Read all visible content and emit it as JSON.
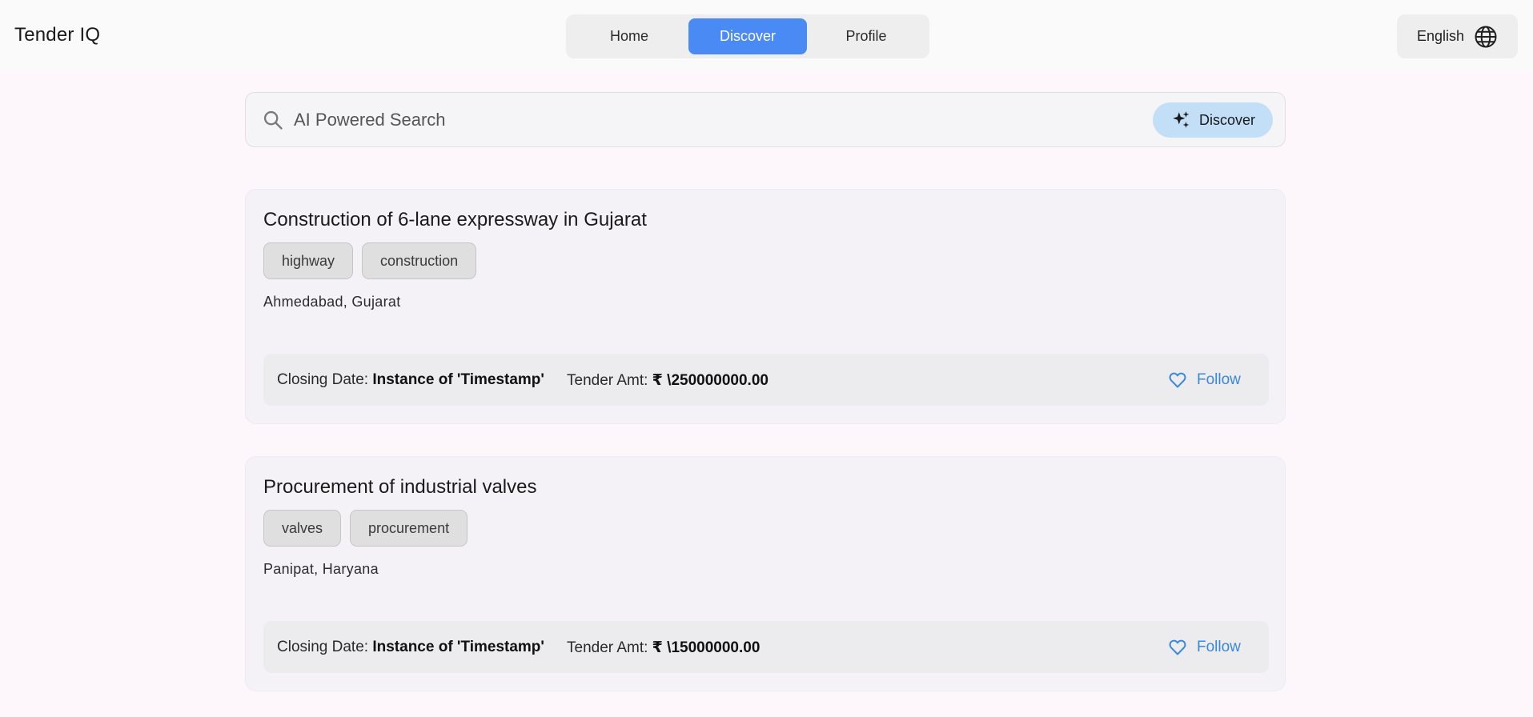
{
  "app": {
    "title": "Tender IQ"
  },
  "nav": {
    "items": [
      {
        "label": "Home"
      },
      {
        "label": "Discover"
      },
      {
        "label": "Profile"
      }
    ],
    "active": "Discover"
  },
  "language": {
    "label": "English",
    "icon": "globe-icon"
  },
  "search": {
    "placeholder": "AI Powered Search",
    "value": "",
    "button_label": "Discover",
    "button_icon": "sparkle-icon"
  },
  "labels": {
    "closing_date": "Closing Date:",
    "tender_amt": "Tender Amt:",
    "follow": "Follow"
  },
  "tenders": [
    {
      "title": "Construction of 6-lane expressway in Gujarat",
      "tags": [
        "highway",
        "construction"
      ],
      "location": "Ahmedabad, Gujarat",
      "closing_date": "Instance of 'Timestamp'",
      "amount": "₹ \\250000000.00"
    },
    {
      "title": "Procurement of industrial valves",
      "tags": [
        "valves",
        "procurement"
      ],
      "location": "Panipat, Haryana",
      "closing_date": "Instance of 'Timestamp'",
      "amount": "₹ \\15000000.00"
    }
  ],
  "colors": {
    "accent": "#4a8af4",
    "discover_button": "#c2dff7",
    "follow": "#3b88d9"
  }
}
